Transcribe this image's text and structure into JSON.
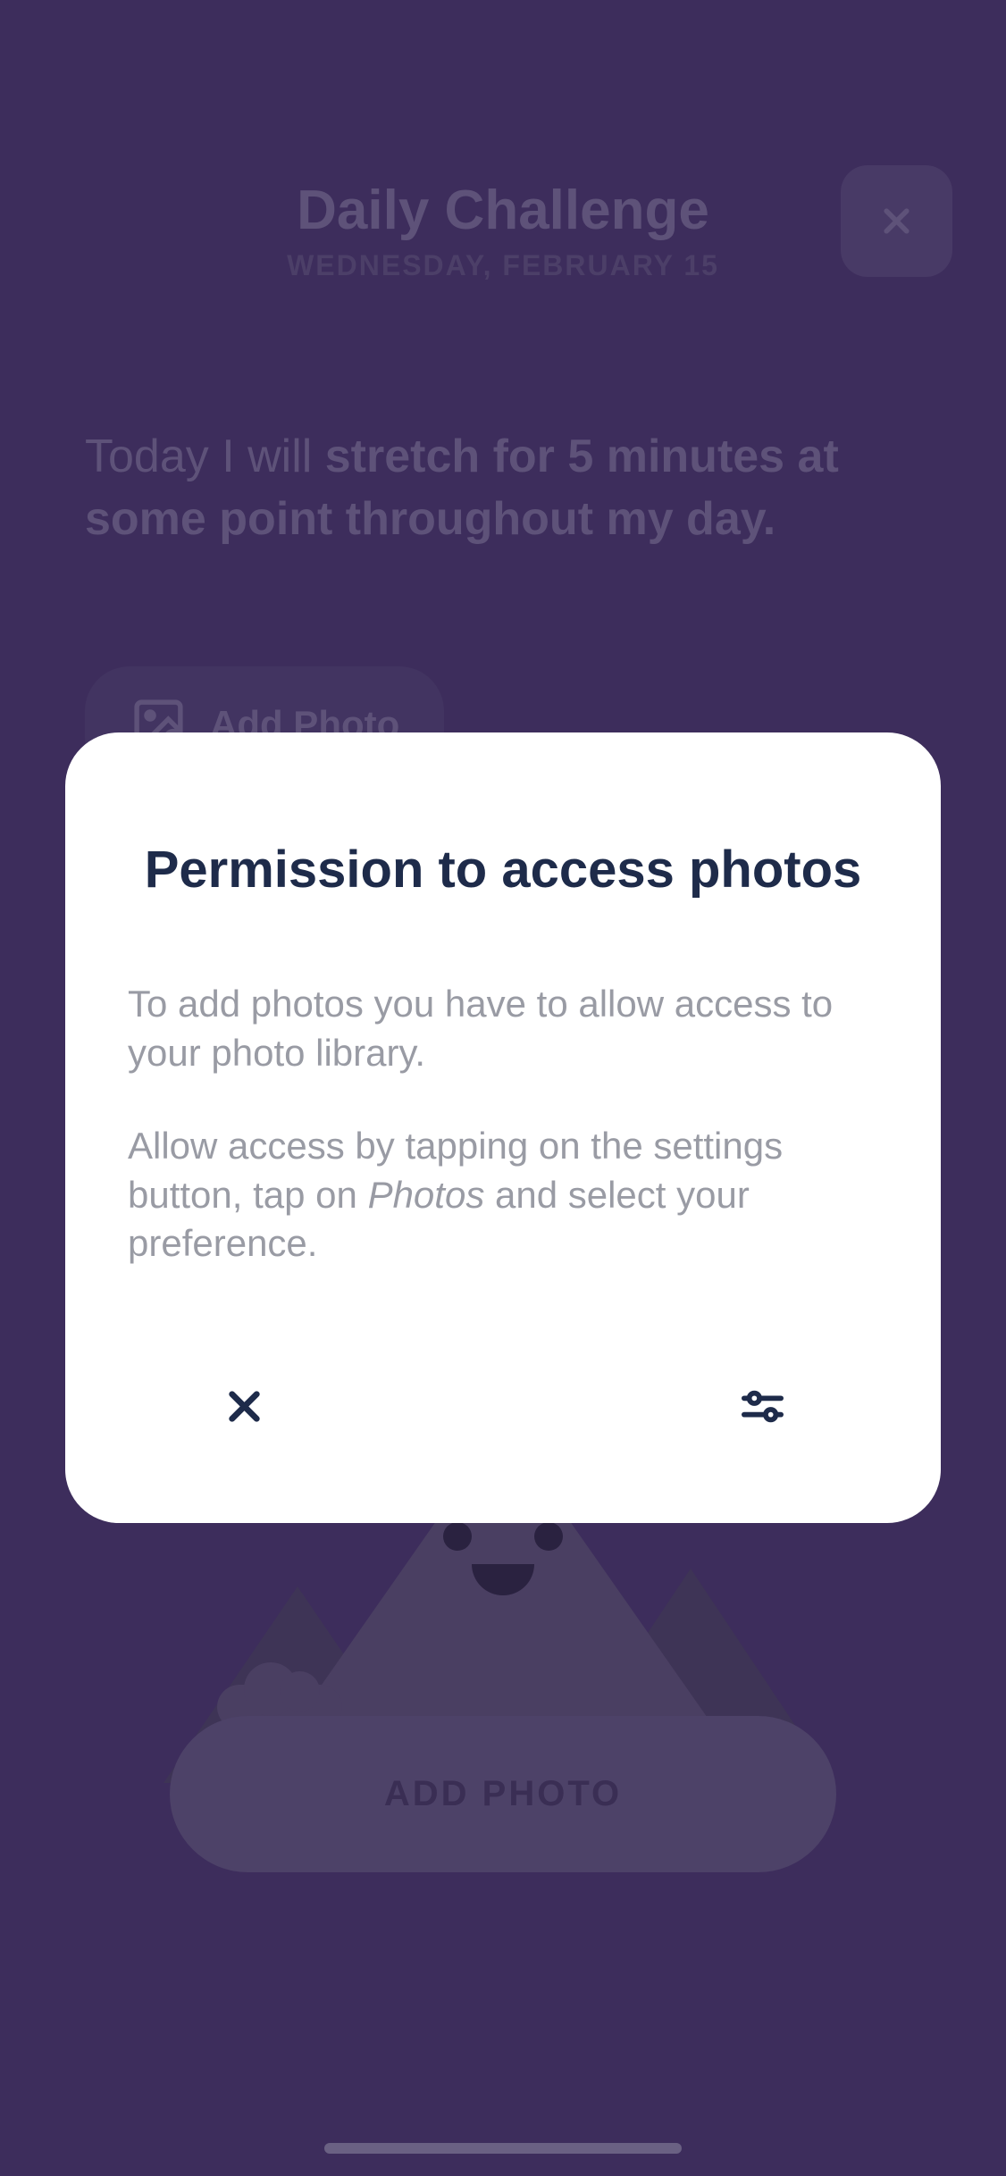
{
  "header": {
    "title": "Daily Challenge",
    "date": "WEDNESDAY, FEBRUARY 15"
  },
  "challenge": {
    "prefix": "Today I will ",
    "text": "stretch for 5 minutes at some point throughout my day."
  },
  "addPhotoPill": {
    "label": "Add Photo"
  },
  "addPhotoButton": {
    "label": "ADD PHOTO"
  },
  "modal": {
    "title": "Permission to access photos",
    "body1": "To add photos you have to allow access to your photo library.",
    "body2_pre": "Allow access by tapping on the settings button, tap on ",
    "body2_italic": "Photos",
    "body2_post": " and select your preference."
  }
}
